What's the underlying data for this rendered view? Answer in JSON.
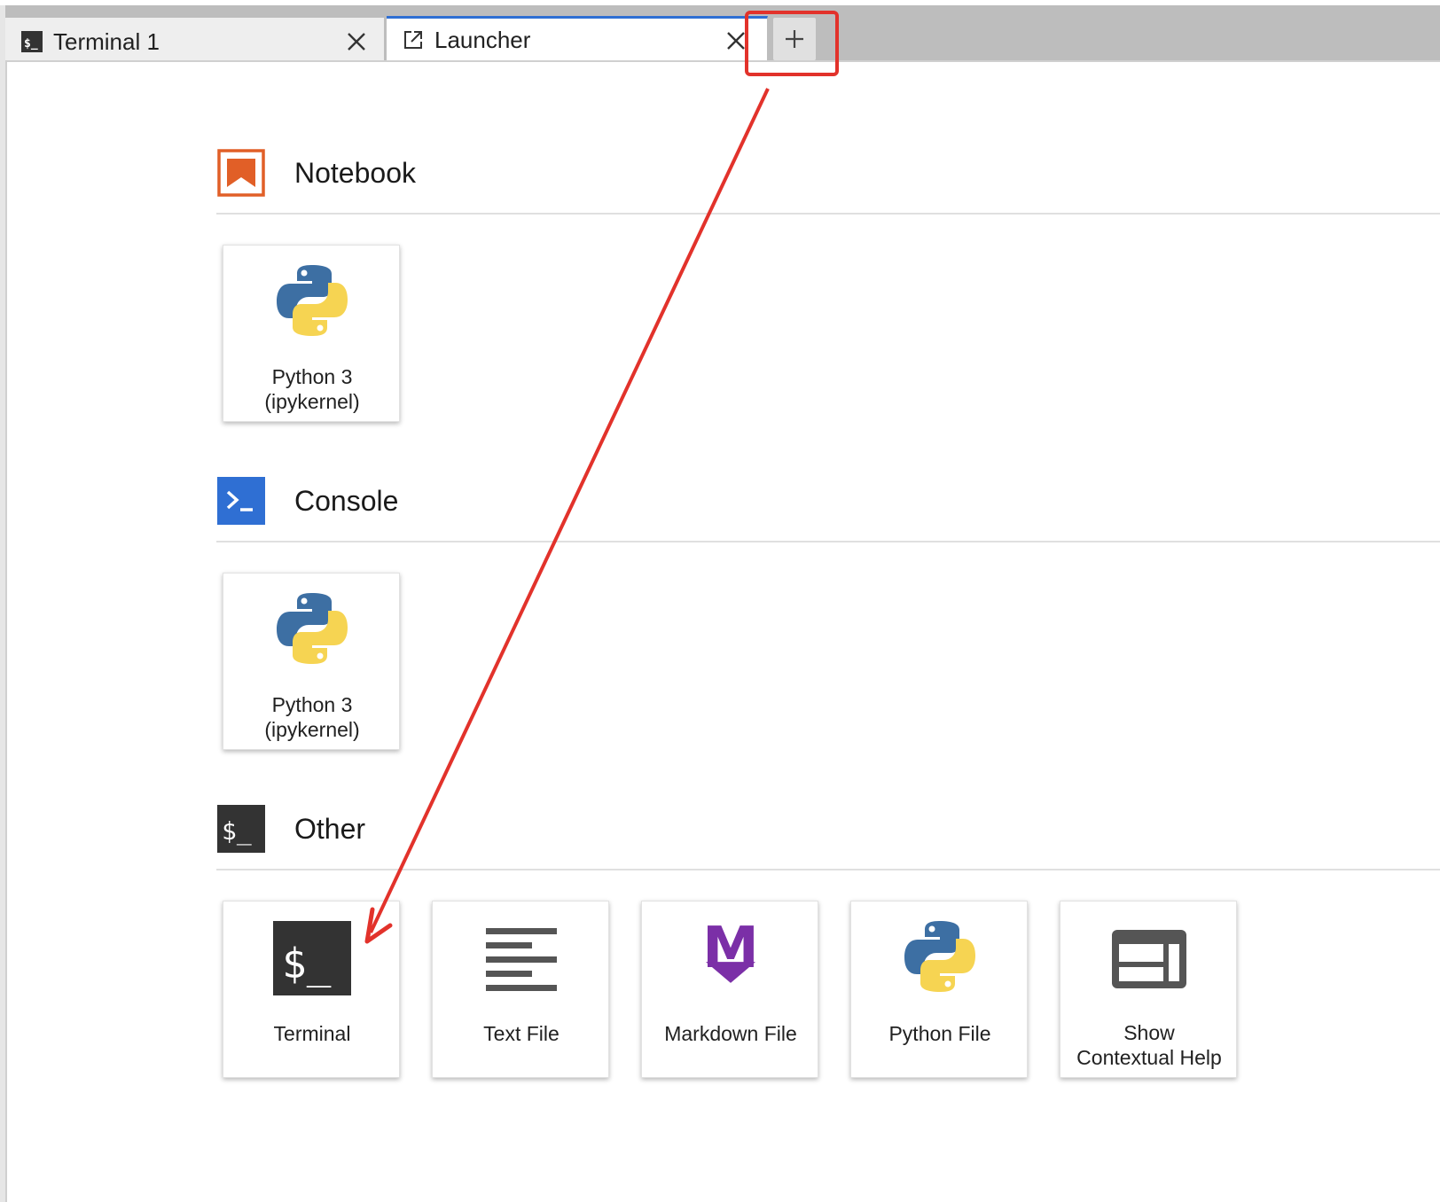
{
  "tabs": [
    {
      "label": "Terminal 1",
      "icon": "terminal-icon",
      "active": false
    },
    {
      "label": "Launcher",
      "icon": "launcher-icon",
      "active": true
    }
  ],
  "add_tab": {
    "icon": "plus-icon"
  },
  "sections": [
    {
      "title": "Notebook",
      "icon": "notebook-icon",
      "color": "#e15f27",
      "cards": [
        {
          "label": "Python 3\n(ipykernel)",
          "icon": "python-icon"
        }
      ]
    },
    {
      "title": "Console",
      "icon": "console-icon",
      "color": "#2f6fd3",
      "cards": [
        {
          "label": "Python 3\n(ipykernel)",
          "icon": "python-icon"
        }
      ]
    },
    {
      "title": "Other",
      "icon": "terminal-icon",
      "color": "#333333",
      "cards": [
        {
          "label": "Terminal",
          "icon": "terminal-icon"
        },
        {
          "label": "Text File",
          "icon": "text-file-icon"
        },
        {
          "label": "Markdown File",
          "icon": "markdown-icon"
        },
        {
          "label": "Python File",
          "icon": "python-icon"
        },
        {
          "label": "Show\nContextual Help",
          "icon": "contextual-help-icon"
        }
      ]
    }
  ],
  "annotation": {
    "color": "#e2322b"
  }
}
